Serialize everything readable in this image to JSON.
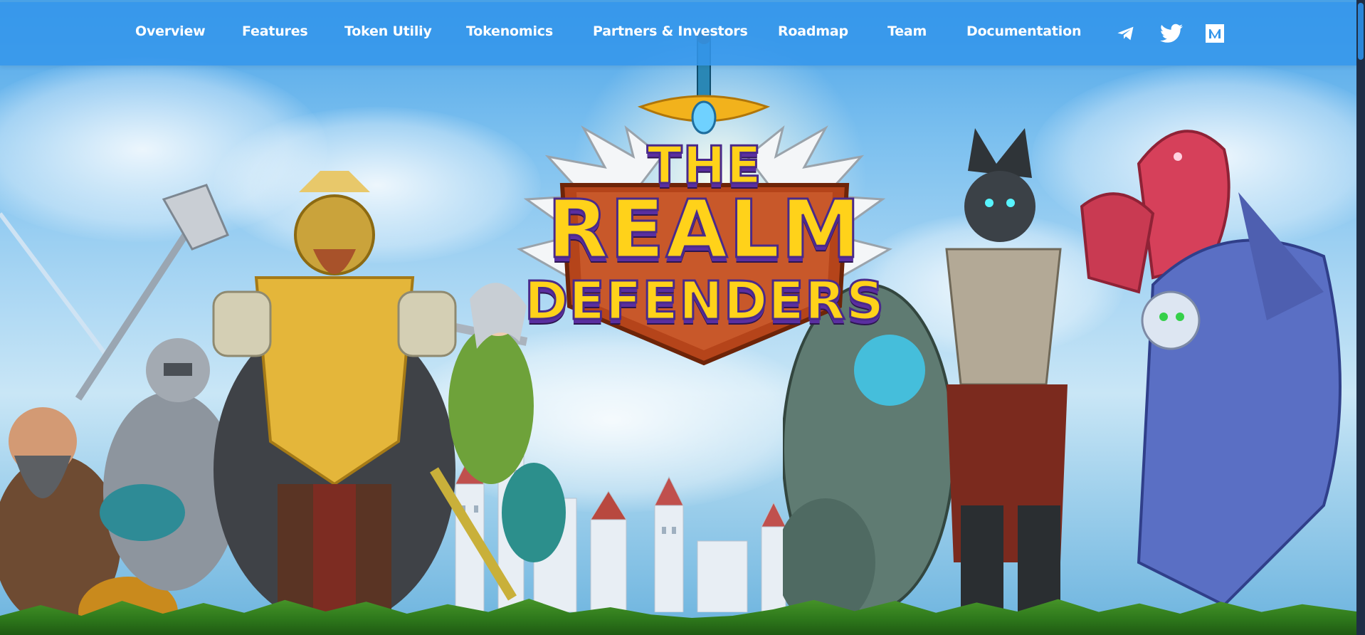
{
  "nav": {
    "links": [
      {
        "label": "Overview"
      },
      {
        "label": "Features"
      },
      {
        "label": "Token Utiliy"
      },
      {
        "label": "Tokenomics"
      },
      {
        "label": "Partners & Investors"
      },
      {
        "label": "Roadmap"
      },
      {
        "label": "Team"
      },
      {
        "label": "Documentation"
      }
    ],
    "social": [
      {
        "icon": "telegram-icon"
      },
      {
        "icon": "twitter-icon"
      },
      {
        "icon": "medium-icon"
      }
    ]
  },
  "hero": {
    "logo": {
      "line1": "THE",
      "line2": "REALM",
      "line3": "DEFENDERS"
    }
  },
  "colors": {
    "nav_bg": "#3496eb",
    "logo_text": "#ffd21a",
    "logo_outline": "#4a2a8a",
    "logo_shield": "#b5441a"
  }
}
